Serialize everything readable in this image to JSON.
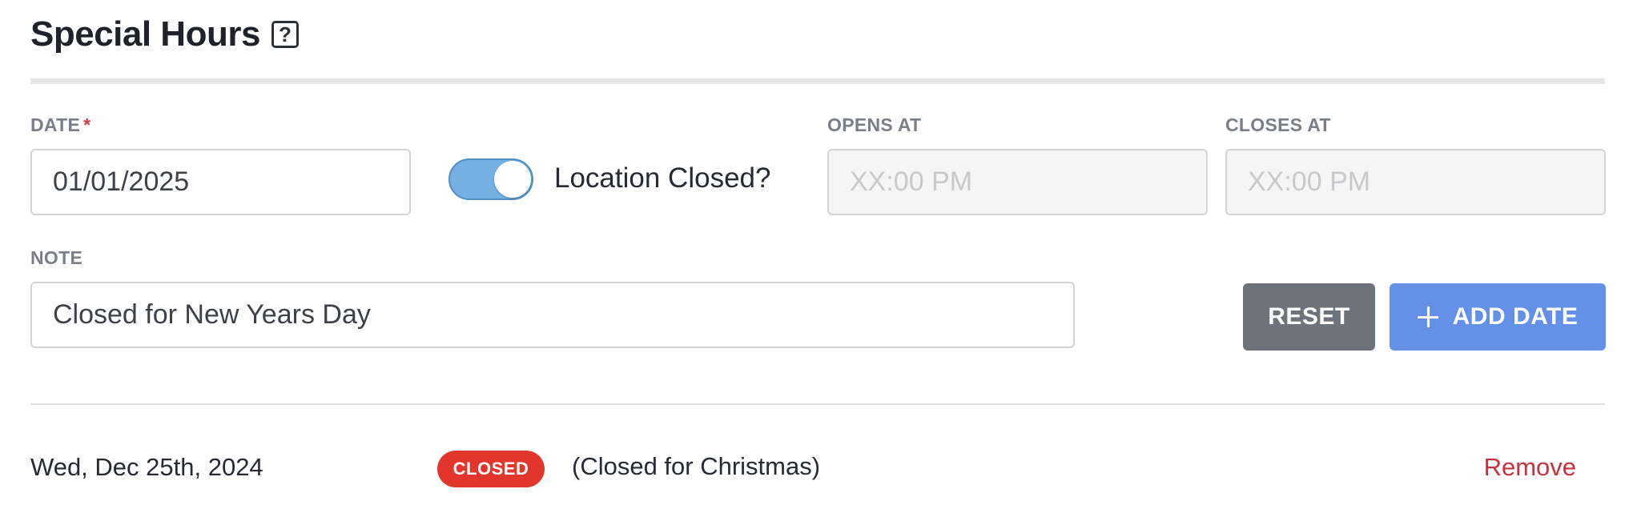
{
  "header": {
    "title": "Special Hours",
    "help_icon": "?"
  },
  "form": {
    "date": {
      "label": "DATE",
      "required_mark": "*",
      "value": "01/01/2025"
    },
    "location_closed": {
      "label": "Location Closed?",
      "checked": true
    },
    "opens_at": {
      "label": "OPENS AT",
      "placeholder": "XX:00 PM"
    },
    "closes_at": {
      "label": "CLOSES AT",
      "placeholder": "XX:00 PM"
    },
    "note": {
      "label": "NOTE",
      "value": "Closed for New Years Day"
    },
    "reset_label": "RESET",
    "add_label": "ADD DATE"
  },
  "entries": [
    {
      "date": "Wed, Dec 25th, 2024",
      "badge": "CLOSED",
      "note": "(Closed for Christmas)",
      "remove_label": "Remove"
    }
  ],
  "colors": {
    "toggle_on": "#74b0e1",
    "reset_button": "#6c737b",
    "add_button": "#6590ea",
    "closed_badge": "#e2362c",
    "remove_link": "#c8323c",
    "required": "#d9383a"
  }
}
